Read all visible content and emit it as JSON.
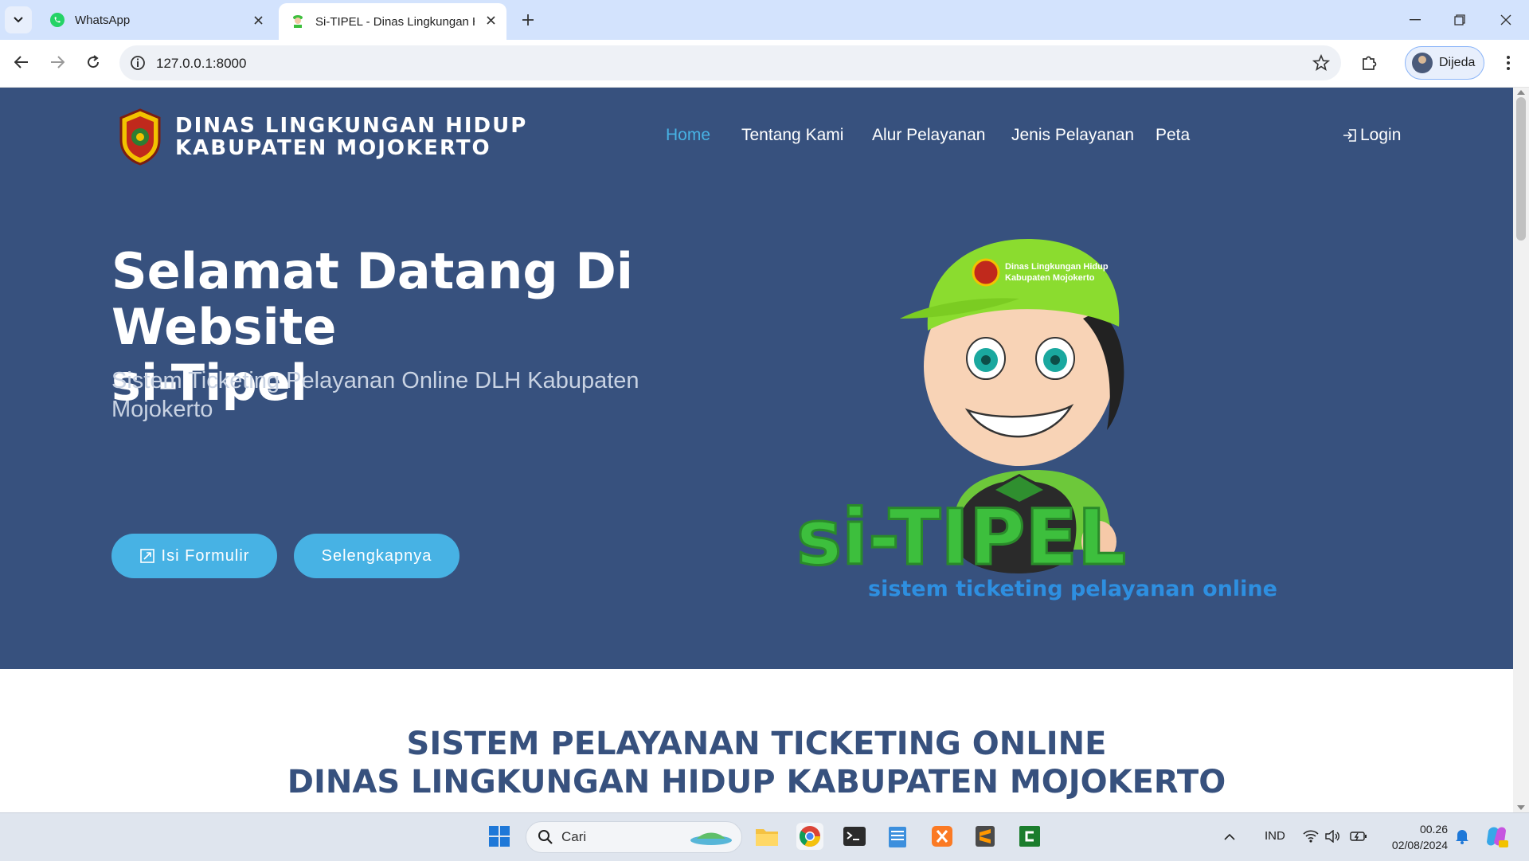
{
  "browser": {
    "tabs": [
      {
        "title": "WhatsApp",
        "active": false
      },
      {
        "title": "Si-TIPEL - Dinas Lingkungan Hid",
        "active": true
      }
    ],
    "url": "127.0.0.1:8000",
    "profile_name": "Dijeda"
  },
  "site": {
    "brand_line1": "DINAS LINGKUNGAN HIDUP",
    "brand_line2": "KABUPATEN MOJOKERTO",
    "nav": [
      {
        "label": "Home",
        "active": true
      },
      {
        "label": "Tentang Kami",
        "active": false
      },
      {
        "label": "Alur Pelayanan",
        "active": false
      },
      {
        "label": "Jenis Pelayanan",
        "active": false
      },
      {
        "label": "Peta",
        "active": false
      }
    ],
    "login_label": "Login",
    "hero_title_line1": "Selamat Datang Di Website",
    "hero_title_line2": "si-Tipel",
    "hero_subtitle": "Sistem Ticketing Pelayanan Online DLH Kabupaten Mojokerto",
    "buttons": {
      "primary": "Isi Formulir",
      "secondary": "Selengkapnya"
    },
    "mascot": {
      "cap_text_line1": "Dinas Lingkungan Hidup",
      "cap_text_line2": "Kabupaten Mojokerto",
      "logo_text": "si-TIPEL",
      "logo_tagline": "sistem ticketing pelayanan online"
    },
    "section_title_line1": "SISTEM PELAYANAN TICKETING ONLINE",
    "section_title_line2": "DINAS LINGKUNGAN HIDUP KABUPATEN MOJOKERTO"
  },
  "taskbar": {
    "search_placeholder": "Cari",
    "language": "IND",
    "time": "00.26",
    "date": "02/08/2024"
  },
  "colors": {
    "hero_bg": "#37517e",
    "accent": "#47b2e4",
    "mascot_green": "#3dbf3d"
  }
}
